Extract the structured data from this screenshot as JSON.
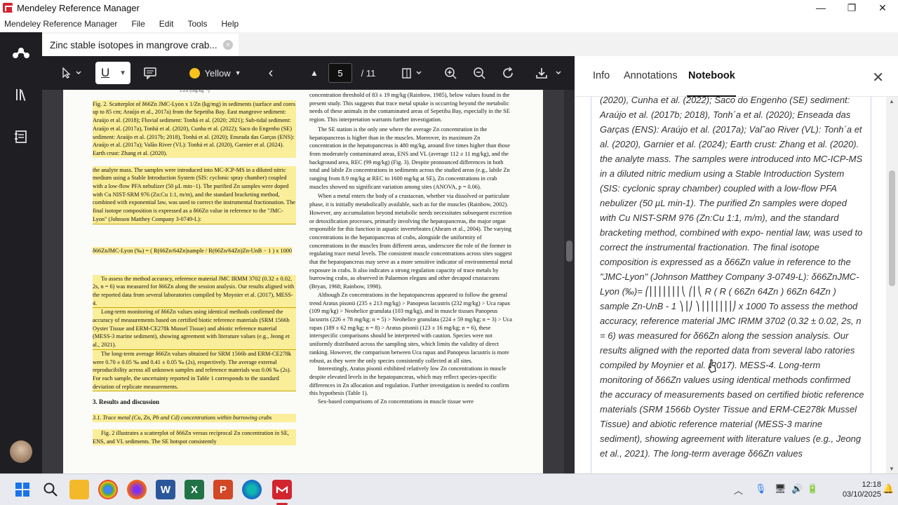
{
  "window": {
    "title": "Mendeley Reference Manager",
    "minimize": "—",
    "maximize": "❐",
    "close": "✕"
  },
  "menu": {
    "app": "Mendeley Reference Manager",
    "file": "File",
    "edit": "Edit",
    "tools": "Tools",
    "help": "Help"
  },
  "tab": {
    "title": "Zinc stable isotopes in mangrove crab...",
    "close": "×"
  },
  "toolbar": {
    "highlight_color": "Yellow",
    "underline_label": "U",
    "page_current": "5",
    "page_total": "/ 11"
  },
  "side_panel": {
    "tabs": [
      "Info",
      "Annotations",
      "Notebook"
    ],
    "active_tab": "Notebook",
    "close": "✕",
    "notebook_text": "(2020), Cunha et al. (2022); Saco do Engenho (SE) sediment: Araújo et al. (2017b; 2018), Tonh´a et al. (2020); Enseada das Garças (ENS): Araújo et al. (2017a); Val˜ao River (VL): Tonh´a et al. (2020), Garnier et al. (2024); Earth crust: Zhang et al. (2020). the analyte mass. The samples were introduced into MC-ICP-MS in a diluted nitric medium using a Stable Introduction System (SIS: cyclonic spray chamber) coupled with a low-flow PFA nebulizer (50 µL min-1). The purified Zn samples were doped with Cu NIST-SRM 976 (Zn:Cu 1:1, m/m), and the standard bracketing method, combined with expo- nential law, was used to correct the instrumental fractionation. The final isotope composition is expressed as a δ66Zn value in reference to the \"JMC-Lyon\" (Johnson Matthey Company 3-0749-L): δ66ZnJMC-Lyon (‰)= ⎛⎜⎜⎜⎜⎜⎜⎜⎝ ⎛⎜⎝ R ( R ( 66Zn 64Zn ) 66Zn 64Zn ) sample Zn-UnB - 1 ⎞⎟⎠ ⎞⎟⎟⎟⎟⎟⎟⎟⎠ x 1000 To assess the method accuracy, reference material JMC IRMM 3702 (0.32 ± 0.02, 2s, n = 6) was measured for δ66Zn along the session analysis. Our results aligned with the reported data from several labo ratories compiled by Moynier et al. (2017). MESS-4. Long-term monitoring of δ66Zn values using identical methods confirmed the accuracy of measurements based on certified biotic reference materials (SRM 1566b Oyster Tissue and ERM-CE278k Mussel Tissue) and abiotic reference material (MESS-3 marine sediment), showing agreement with literature values (e.g., Jeong et al., 2021). The long-term average δ66Zn values"
  },
  "pdf": {
    "fig_caption": "Fig. 2. Scatterplot of δ66Zn JMC-Lyon x 1/Zn (kg/mg) in sediments (surface and cores up to 85 cm; Araújo et al., 2017a) from the Sepetiba Bay. East mangrove sediment: Araújo et al. (2018); Fluvial sediment: Tonhá et al. (2020; 2021); Sub-tidal sediment: Araújo et al. (2017a), Tonhá et al. (2020), Cunha et al. (2022); Saco do Engenho (SE) sediment: Araújo et al. (2017b; 2018), Tonhá et al. (2020); Enseada das Garças (ENS): Araújo et al. (2017a); Valão River (VL): Tonhá et al. (2020), Garnier et al. (2024). Earth crust: Zhang et al. (2020).",
    "para1": "the analyte mass. The samples were introduced into MC-ICP-MS in a diluted nitric medium using a Stable Introduction System (SIS: cyclonic spray chamber) coupled with a low-flow PFA nebulizer (50 µL min−1). The purified Zn samples were doped with Cu NIST-SRM 976 (Zn:Cu 1:1, m/m), and the standard bracketing method, combined with exponential law, was used to correct the instrumental fractionation. The final isotope composition is expressed as a δ66Zn value in reference to the \"JMC-Lyon\" (Johnson Matthey Company 3-0749-L):",
    "equation": "δ66ZnJMC-Lyon (‰) = ( R(66Zn/64Zn)sample / R(66Zn/64Zn)Zn-UnB − 1 ) x 1000",
    "para2": "To assess the method accuracy, reference material JMC IRMM 3702 (0.32 ± 0.02, 2s, n = 6) was measured for δ66Zn along the session analysis. Our results aligned with the reported data from several laboratories compiled by Moynier et al. (2017), MESS-4.",
    "para3": "Long-term monitoring of δ66Zn values using identical methods confirmed the accuracy of measurements based on certified biotic reference materials (SRM 1566b Oyster Tissue and ERM-CE278k Mussel Tissue) and abiotic reference material (MESS-3 marine sediment), showing agreement with literature values (e.g., Jeong et al., 2021).",
    "para4": "The long-term average δ66Zn values obtained for SRM 1566b and ERM-CE278k were 0.70 ± 0.05 ‰ and 0.41 ± 0.05 ‰ (2s), respectively. The average external reproducibility across all unknown samples and reference materials was 0.06 ‰ (2s). For each sample, the uncertainty reported in Table 1 corresponds to the standard deviation of replicate measurements.",
    "section3": "3.  Results and discussion",
    "section31": "3.1.  Trace metal (Cu, Zn, Pb and Cd) concentrations within burrowing crabs",
    "para5": "Fig. 2 illustrates a scatterplot of δ66Zn versus reciprocal Zn concentration in SE, ENS, and VL sediments. The SE hotspot consistently",
    "r1": "concentration threshold of 83 ± 19 mg/kg (Rainbow, 1985), below values found in the present study. This suggests that trace metal uptake is occurring beyond the metabolic needs of these animals in the contaminated areas of Sepetiba Bay, especially in the SE region. This interpretation warrants further investigation.",
    "r2": "The SE station is the only one where the average Zn concentration in the hepatopancreas is higher than in the muscles. Moreover, its maximum Zn concentration in the hepatopancreas is 480 mg/kg, around five times higher than those from moderately contaminated areas, ENS and VL (average 112 ± 11 mg/kg), and the background area, REC (99 mg/kg) (Fig. 3). Despite pronounced differences in both total and labile Zn concentrations in sediments across the studied areas (e.g., labile Zn ranging from 8.9 mg/kg at REC to 1600 mg/kg at SE), Zn concentrations in crab muscles showed no significant variation among sites (ANOVA, p = 0.06).",
    "r3": "When a metal enters the body of a crustacean, whether via dissolved or particulate phase, it is initially metabolically available, such as for the muscles (Rainbow, 2002). However, any accumulation beyond metabolic needs necessitates subsequent excretion or detoxification processes, primarily involving the hepatopancreas, the major organ responsible for this function in aquatic invertebrates (Ahearn et al., 2004). The varying concentrations in the hepatopancreas of crabs, alongside the uniformity of concentrations in the muscles from different areas, underscore the role of the former in regulating trace metal levels. The consistent muscle concentrations across sites suggest that the hepatopancreas may serve as a more sensitive indicator of environmental metal exposure in crabs. It also indicates a strong regulation capacity of trace metals by burrowing crabs, as observed in Palaemon elegans and other decapod crustaceans (Bryan, 1968; Rainbow, 1998).",
    "r4": "Although Zn concentrations in the hepatopancreas appeared to follow the general trend Aratus pisonii (235 ± 213 mg/kg) > Panopeus lacustris (232 mg/kg) > Uca rapax (109 mg/kg) > Neohelice granulata (103 mg/kg), and in muscle tissues Panopeus lacustris (226 ± 78 mg/kg; n = 5) > Neohelice granulata (224 ± 59 mg/kg; n = 3) > Uca rapax (189 ± 62 mg/kg; n = 8) > Aratus pisonii (123 ± 16 mg/kg; n = 6), these interspecific comparisons should be interpreted with caution. Species were not uniformly distributed across the sampling sites, which limits the validity of direct ranking. However, the comparison between Uca rapax and Panopeus lacustris is more robust, as they were the only species consistently collected at all sites.",
    "r5": "Interestingly, Aratus pisonii exhibited relatively low Zn concentrations in muscle despite elevated levels in the hepatopancreas, which may reflect species-specific differences in Zn allocation and regulation. Further investigation is needed to confirm this hypothesis (Table 1).",
    "r6": "Sex-based comparisons of Zn concentrations in muscle tissue were"
  },
  "taskbar": {
    "time": "12:18",
    "date": "03/10/2025"
  }
}
